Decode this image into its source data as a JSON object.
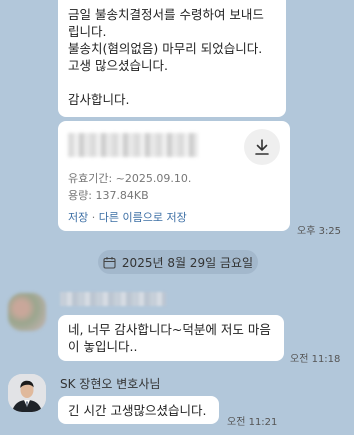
{
  "messages": {
    "top_bubble": {
      "line1": "금일 불송치결정서를 수령하여 보내드",
      "line2": "립니다.",
      "line3": "불송치(혐의없음) 마무리 되었습니다.",
      "line4": "고생 많으셨습니다.",
      "line5": "감사합니다."
    },
    "file": {
      "expiry": "유효기간: ~2025.09.10.",
      "size": "용량: 137.84KB",
      "save_label": "저장",
      "separator": "·",
      "save_as_label": "다른 이름으로 저장",
      "icon": "download-icon",
      "time": "오후 3:25"
    },
    "date_separator": {
      "text": "2025년 8월 29일 금요일",
      "icon": "calendar-icon"
    },
    "incoming1": {
      "text": "네, 너무 감사합니다~덕분에 저도 마음이 놓입니다..",
      "time": "오전 11:18"
    },
    "incoming2": {
      "sender": "SK 장현오 변호사님",
      "text": "긴 시간 고생많으셨습니다.",
      "time": "오전 11:21"
    }
  },
  "colors": {
    "background": "#b2c7da",
    "bubble": "#ffffff",
    "link": "#3d6fa5"
  }
}
